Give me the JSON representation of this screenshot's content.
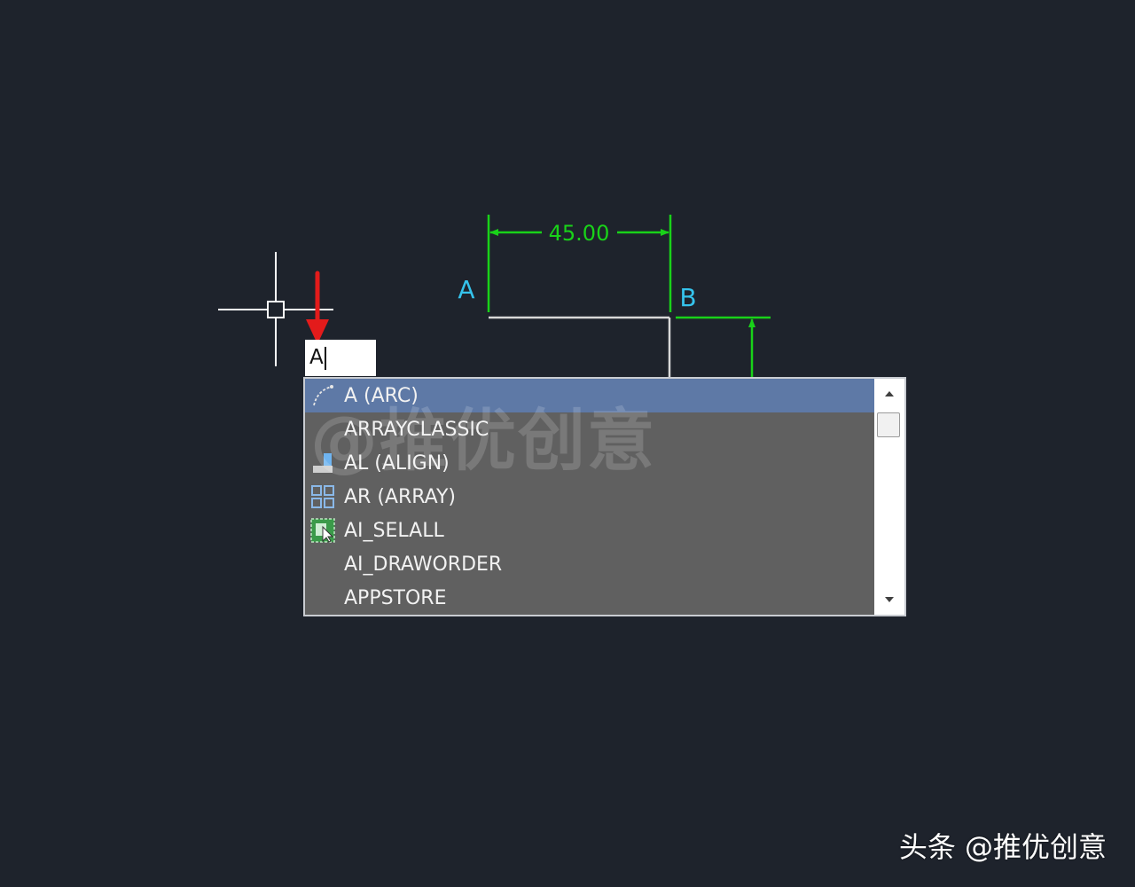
{
  "colors": {
    "background": "#1e232c",
    "dimension": "#19d219",
    "point_label": "#35c3ec",
    "geometry": "#d8d8d8",
    "crosshair": "#ffffff",
    "arrow_marker": "#e31b1b",
    "list_background": "#606060",
    "list_selected": "#5e79a6",
    "list_text": "#f2f2f2"
  },
  "drawing": {
    "dimension_value": "45.00",
    "point_a": "A",
    "point_b": "B"
  },
  "command_line": {
    "value": "A"
  },
  "autocomplete": {
    "watermark": "@推优创意",
    "items": [
      {
        "label": "A (ARC)",
        "icon": "arc-icon",
        "selected": true
      },
      {
        "label": "ARRAYCLASSIC",
        "icon": "",
        "selected": false
      },
      {
        "label": "AL (ALIGN)",
        "icon": "align-icon",
        "selected": false
      },
      {
        "label": "AR (ARRAY)",
        "icon": "array-icon",
        "selected": false
      },
      {
        "label": "AI_SELALL",
        "icon": "select-all-icon",
        "selected": false
      },
      {
        "label": "AI_DRAWORDER",
        "icon": "",
        "selected": false
      },
      {
        "label": "APPSTORE",
        "icon": "",
        "selected": false
      }
    ]
  },
  "brand_watermark": "头条 @推优创意"
}
